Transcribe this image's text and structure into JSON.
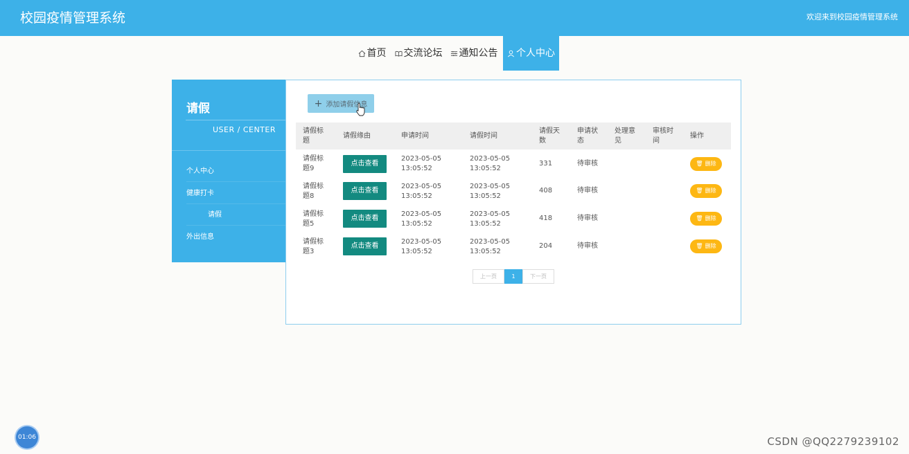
{
  "header": {
    "title": "校园疫情管理系统",
    "welcome": "欢迎来到校园疫情管理系统"
  },
  "nav": {
    "items": [
      {
        "label": "首页",
        "icon": "home-icon"
      },
      {
        "label": "交流论坛",
        "icon": "forum-icon"
      },
      {
        "label": "通知公告",
        "icon": "notice-icon"
      },
      {
        "label": "个人中心",
        "icon": "user-icon",
        "active": true
      }
    ]
  },
  "sidebar": {
    "title": "请假",
    "subtitle": "USER / CENTER",
    "items": [
      {
        "label": "个人中心"
      },
      {
        "label": "健康打卡"
      },
      {
        "label": "请假"
      },
      {
        "label": "外出信息"
      }
    ]
  },
  "main": {
    "add_button": "添加请假信息",
    "columns": [
      "请假标题",
      "请假缘由",
      "申请时间",
      "请假时间",
      "请假天数",
      "申请状态",
      "处理意见",
      "审核时间",
      "操作"
    ],
    "rows": [
      {
        "title": "请假标题9",
        "reason_btn": "点击查看",
        "apply_date": "2023-05-05",
        "apply_time": "13:05:52",
        "leave_date": "2023-05-05",
        "leave_time": "13:05:52",
        "days": "331",
        "status": "待审核",
        "opinion": "",
        "review_time": "",
        "delete": "删除"
      },
      {
        "title": "请假标题8",
        "reason_btn": "点击查看",
        "apply_date": "2023-05-05",
        "apply_time": "13:05:52",
        "leave_date": "2023-05-05",
        "leave_time": "13:05:52",
        "days": "408",
        "status": "待审核",
        "opinion": "",
        "review_time": "",
        "delete": "删除"
      },
      {
        "title": "请假标题5",
        "reason_btn": "点击查看",
        "apply_date": "2023-05-05",
        "apply_time": "13:05:52",
        "leave_date": "2023-05-05",
        "leave_time": "13:05:52",
        "days": "418",
        "status": "待审核",
        "opinion": "",
        "review_time": "",
        "delete": "删除"
      },
      {
        "title": "请假标题3",
        "reason_btn": "点击查看",
        "apply_date": "2023-05-05",
        "apply_time": "13:05:52",
        "leave_date": "2023-05-05",
        "leave_time": "13:05:52",
        "days": "204",
        "status": "待审核",
        "opinion": "",
        "review_time": "",
        "delete": "删除"
      }
    ]
  },
  "pagination": {
    "prev": "上一页",
    "current": "1",
    "next": "下一页"
  },
  "overlay": {
    "timer": "01:06",
    "watermark": "CSDN @QQ2279239102"
  },
  "colors": {
    "primary": "#3db1e8",
    "view_button": "#138a80",
    "delete_button": "#fdb713"
  }
}
